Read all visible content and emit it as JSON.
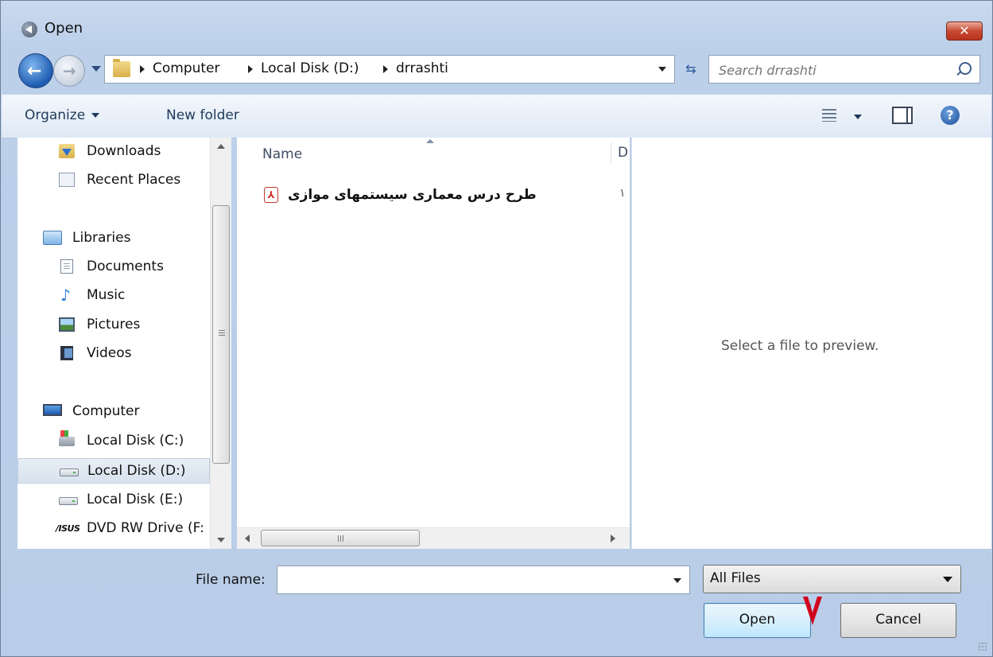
{
  "window": {
    "title": "Open",
    "close_label": "✕"
  },
  "navigation": {
    "breadcrumbs": [
      "Computer",
      "Local Disk (D:)",
      "drrashti"
    ],
    "search_placeholder": "Search drrashti"
  },
  "toolbar": {
    "organize_label": "Organize",
    "new_folder_label": "New folder"
  },
  "nav_pane": {
    "items": [
      {
        "label": "Downloads",
        "icon": "downloads-folder-icon"
      },
      {
        "label": "Recent Places",
        "icon": "recent-places-icon"
      },
      {
        "label": "Libraries",
        "icon": "libraries-icon"
      },
      {
        "label": "Documents",
        "icon": "documents-icon"
      },
      {
        "label": "Music",
        "icon": "music-icon"
      },
      {
        "label": "Pictures",
        "icon": "pictures-icon"
      },
      {
        "label": "Videos",
        "icon": "videos-icon"
      },
      {
        "label": "Computer",
        "icon": "computer-icon"
      },
      {
        "label": "Local Disk (C:)",
        "icon": "system-disk-icon"
      },
      {
        "label": "Local Disk (D:)",
        "icon": "disk-icon",
        "selected": true
      },
      {
        "label": "Local Disk (E:)",
        "icon": "disk-icon"
      },
      {
        "label": "DVD RW Drive (F:",
        "icon": "asus-dvd-icon"
      }
    ]
  },
  "file_list": {
    "columns": [
      "Name",
      "D"
    ],
    "files": [
      {
        "name": "طرح درس معماری سیستمهای موازی",
        "icon": "pdf-icon",
        "extra": "۱"
      }
    ]
  },
  "preview": {
    "message": "Select a file to preview."
  },
  "bottom": {
    "file_name_label": "File name:",
    "file_name_value": "",
    "file_type": "All Files",
    "open_label": "Open",
    "cancel_label": "Cancel"
  },
  "colors": {
    "accent": "#3c7fb1",
    "annotation_mark": "#d0021b",
    "pdf": "#d32f2f"
  }
}
